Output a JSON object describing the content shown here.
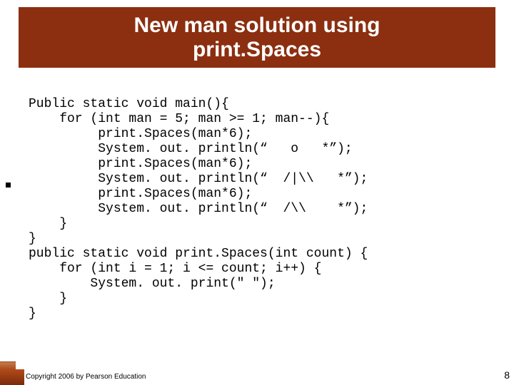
{
  "title": "New man solution using\nprint.Spaces",
  "code": "Public static void main(){\n    for (int man = 5; man >= 1; man--){\n         print.Spaces(man*6);\n         System. out. println(“   o   *”);\n         print.Spaces(man*6);\n         System. out. println(“  /|\\\\   *”);\n         print.Spaces(man*6);\n         System. out. println(“  /\\\\    *”);\n    }\n}\npublic static void print.Spaces(int count) {\n    for (int i = 1; i <= count; i++) {\n        System. out. print(\" \");\n    }\n}",
  "copyright": "Copyright 2006 by Pearson Education",
  "page_number": "8"
}
